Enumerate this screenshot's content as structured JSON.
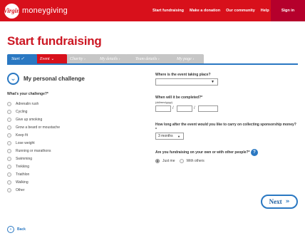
{
  "brand": {
    "logo_mark": "Virgin",
    "name": "moneygiving"
  },
  "nav": [
    "Start fundraising",
    "Make a donation",
    "Our community",
    "Help"
  ],
  "sign_in": "Sign in",
  "page_title": "Start fundraising",
  "steps": [
    {
      "label": "Start ✓",
      "state": "done"
    },
    {
      "label": "Event ⌄",
      "state": "current"
    },
    {
      "label": "Charity ›",
      "state": "todo"
    },
    {
      "label": "My details ›",
      "state": "todo"
    },
    {
      "label": "Team details ›",
      "state": "todo"
    },
    {
      "label": "My page ›",
      "state": "todo"
    }
  ],
  "section_heading": "My personal challenge",
  "challenge_question": "What's your challenge?*",
  "challenges": [
    "Adrenalin rush",
    "Cycling",
    "Give up smoking",
    "Grow a beard or moustache",
    "Keep fit",
    "Lose weight",
    "Running or marathons",
    "Swimming",
    "Trekking",
    "Triathlon",
    "Walking",
    "Other"
  ],
  "location_question": "Where is the event taking place?",
  "completion_question": "When will it be completed?*",
  "date_hint": "(dd/mm/yyyy)",
  "date_separator": "/",
  "sponsorship_question": "How long after the event would you like to carry on collecting sponsorship money?",
  "sponsorship_required": "*",
  "sponsorship_value": "3 months",
  "team_question": "Are you fundraising on your own or with other people?*",
  "help_mark": "?",
  "team_options": [
    {
      "label": "Just me",
      "selected": true
    },
    {
      "label": "With others",
      "selected": false
    }
  ],
  "next_label": "Next",
  "back_label": "Back",
  "colors": {
    "brand_red": "#d8101b",
    "accent_blue": "#2a78c2",
    "signin_bg": "#b5002c"
  }
}
